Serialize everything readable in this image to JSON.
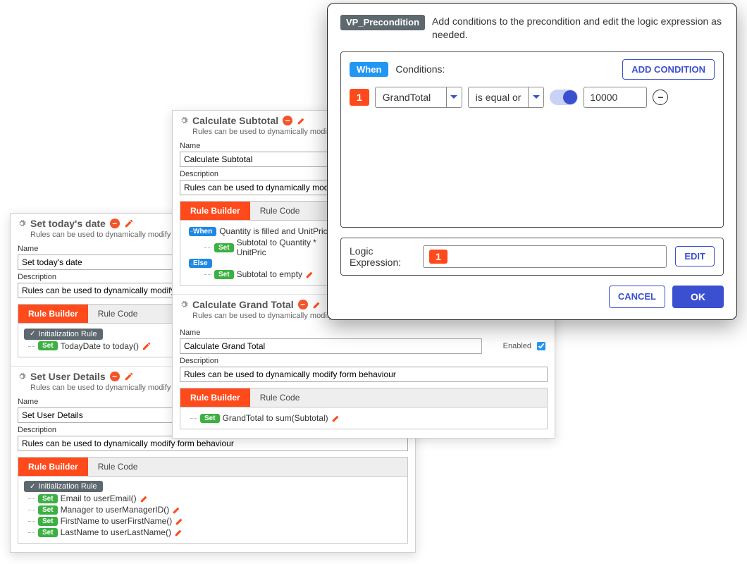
{
  "common": {
    "subtext_short": "Rules can be used to dynamically modify form beha",
    "subtext_med": "Rules can be used to dynamically modify for",
    "subtext_full": "Rules can be used to dynamically modify form behaviour",
    "name_label": "Name",
    "desc_label": "Description",
    "enabled_label": "Enabled",
    "tabs": {
      "builder": "Rule Builder",
      "code": "Rule Code"
    },
    "init_pill": "Initialization Rule",
    "set": "Set",
    "when": "When",
    "else": "Else"
  },
  "panel1_rule1": {
    "title": "Set today's date",
    "name": "Set today's date",
    "desc": "Rules can be used to dynamically modify for",
    "line1": "TodayDate to today()"
  },
  "panel1_rule2": {
    "title": "Set User Details",
    "name": "Set User Details",
    "desc": "Rules can be used to dynamically modify form behaviour",
    "l1": "Email to userEmail()",
    "l2": "Manager to userManagerID()",
    "l3": "FirstName to userFirstName()",
    "l4": "LastName to userLastName()"
  },
  "panel2_rule1": {
    "title": "Calculate Subtotal",
    "name": "Calculate Subtotal",
    "desc": "Rules can be used to dynamically modify for",
    "when_line": "Quantity is filled and UnitPrice",
    "set1": "Subtotal to Quantity * UnitPric",
    "set2": "Subtotal to empty"
  },
  "panel2_rule2": {
    "title": "Calculate Grand Total",
    "name": "Calculate Grand Total",
    "desc": "Rules can be used to dynamically modify form behaviour",
    "line": "GrandTotal to sum(Subtotal)"
  },
  "dialog": {
    "chip": "VP_Precondition",
    "instructions": "Add conditions to the precondition and edit the logic expression as needed.",
    "when": "When",
    "conditions_label": "Conditions:",
    "add_condition": "ADD CONDITION",
    "row_num": "1",
    "field": "GrandTotal",
    "operator": "is equal or",
    "value": "10000",
    "logic_label": "Logic Expression:",
    "logic_value": "1",
    "edit": "EDIT",
    "cancel": "CANCEL",
    "ok": "OK"
  }
}
